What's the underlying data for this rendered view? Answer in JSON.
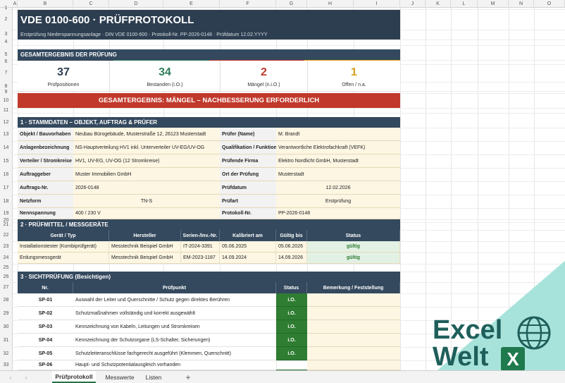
{
  "columns": [
    "A",
    "B",
    "C",
    "D",
    "E",
    "F",
    "G",
    "H",
    "I",
    "J",
    "K",
    "L",
    "M",
    "N",
    "O"
  ],
  "rows": [
    "1",
    "2",
    "3",
    "4",
    "5",
    "6",
    "7",
    "8",
    "9",
    "10",
    "11",
    "12",
    "13",
    "14",
    "15",
    "16",
    "17",
    "18",
    "19",
    "20",
    "21",
    "22",
    "23",
    "24",
    "25",
    "26",
    "27",
    "28",
    "29",
    "30",
    "31",
    "32",
    "33"
  ],
  "header": {
    "title": "VDE 0100-600 · PRÜFPROTOKOLL",
    "subtitle": "Erstprüfung Niederspannungsanlage · DIN VDE 0100-600   ·   Protokoll-Nr. PP-2026-0148   ·   Prüfdatum 12.02.YYYY"
  },
  "summary": {
    "section_title": "GESAMTERGEBNIS DER PRÜFUNG",
    "cards": [
      {
        "value": "37",
        "label": "Prüfpositionen",
        "color": "#2d3e50"
      },
      {
        "value": "34",
        "label": "Bestanden (i.O.)",
        "color": "#2e7d5b"
      },
      {
        "value": "2",
        "label": "Mängel (n.i.O.)",
        "color": "#c0392b"
      },
      {
        "value": "1",
        "label": "Offen / n.a.",
        "color": "#d4a017"
      }
    ],
    "result": "GESAMTERGEBNIS: MÄNGEL – NACHBESSERUNG ERFORDERLICH"
  },
  "stamm": {
    "section_title": "1 · STAMMDATEN – OBJEKT, AUFTRAG & PRÜFER",
    "left": [
      {
        "label": "Objekt / Bauvorhaben",
        "value": "Neubau Bürogebäude, Musterstraße 12, 26123 Musterstadt"
      },
      {
        "label": "Anlagenbezeichnung",
        "value": "NS-Hauptverteilung HV1 inkl. Unterverteiler UV-EG/UV-OG"
      },
      {
        "label": "Verteiler / Stromkreise",
        "value": "HV1, UV-EG, UV-OG (12 Stromkreise)"
      },
      {
        "label": "Auftraggeber",
        "value": "Muster Immobilien GmbH"
      },
      {
        "label": "Auftrags-Nr.",
        "value": "2026-0148"
      },
      {
        "label": "Netzform",
        "value": "TN-S"
      },
      {
        "label": "Nennspannung",
        "value": "400 / 230 V"
      }
    ],
    "right": [
      {
        "label": "Prüfer (Name)",
        "value": "M. Brandt"
      },
      {
        "label": "Qualifikation / Funktion",
        "value": "Verantwortliche Elektrofachkraft (VEFK)"
      },
      {
        "label": "Prüfende Firma",
        "value": "Elektro Nordlicht GmbH, Musterstadt"
      },
      {
        "label": "Ort der Prüfung",
        "value": "Musterstadt"
      },
      {
        "label": "Prüfdatum",
        "value": "12.02.2026"
      },
      {
        "label": "Prüfart",
        "value": "Erstprüfung"
      },
      {
        "label": "Protokoll-Nr.",
        "value": "PP-2026-0148"
      }
    ]
  },
  "mittel": {
    "section_title": "2 · PRÜFMITTEL / MESSGERÄTE",
    "headers": [
      "Gerät / Typ",
      "Hersteller",
      "Serien-/Inv.-Nr.",
      "Kalibriert am",
      "Gültig bis",
      "Status"
    ],
    "rows": [
      [
        "Installationstester (Kombiprüfgerät)",
        "Messtechnik Beispiel GmbH",
        "IT-2024-3391",
        "05.06.2025",
        "05.06.2026",
        "gültig"
      ],
      [
        "Erdungsmessgerät",
        "Messtechnik Beispiel GmbH",
        "EM-2023-1187",
        "14.09.2024",
        "14.09.2026",
        "gültig"
      ]
    ]
  },
  "sicht": {
    "section_title": "3 · SICHTPRÜFUNG (Besichtigen)",
    "headers": [
      "Nr.",
      "Prüfpunkt",
      "Status",
      "Bemerkung / Feststellung"
    ],
    "rows": [
      [
        "SP-01",
        "Auswahl der Leiter und Querschnitte / Schutz gegen direktes Berühren",
        "i.O."
      ],
      [
        "SP-02",
        "Schutzmaßnahmen vollständig und korrekt ausgewählt",
        "i.O."
      ],
      [
        "SP-03",
        "Kennzeichnung von Kabeln, Leitungen und Stromkreisen",
        "i.O."
      ],
      [
        "SP-04",
        "Kennzeichnung der Schutzorgane (LS-Schalter, Sicherungen)",
        "i.O."
      ],
      [
        "SP-05",
        "Schutzleiteranschlüsse fachgerecht ausgeführt (Klemmen, Querschnitt)",
        "i.O."
      ],
      [
        "SP-06",
        "Haupt- und Schutzpotentialausgleich vorhanden",
        ""
      ]
    ]
  },
  "tabs": {
    "active": "Prüfprotokoll",
    "items": [
      "Prüfprotokoll",
      "Messwerte",
      "Listen"
    ],
    "add": "+",
    "prev": "‹",
    "next": "›"
  },
  "logo": {
    "line1": "Excel",
    "line2": "Welt",
    "badge": "X"
  }
}
